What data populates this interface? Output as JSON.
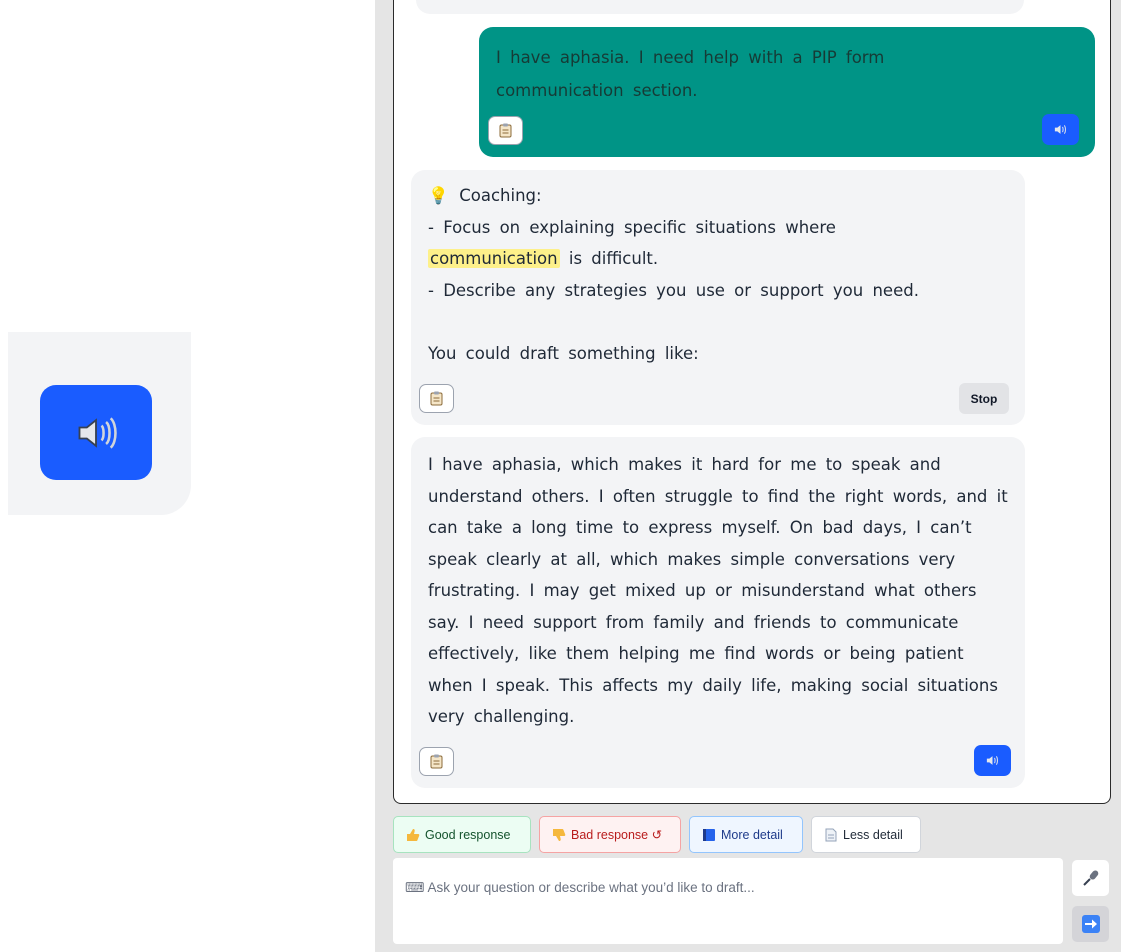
{
  "chat": {
    "user_message": "I have aphasia. I need help with a PIP form communication section.",
    "coaching": {
      "heading": "Coaching:",
      "line1_before": "- Focus on explaining specific situations where",
      "highlight": "communication",
      "line1_after": "is difficult.",
      "line2": "- Describe any strategies you use or support you need.",
      "line3": "You could draft something like:",
      "stop_label": "Stop"
    },
    "draft": "I have aphasia, which makes it hard for me to speak and understand others. I often struggle to find the right words, and it can take a long time to express myself. On bad days, I can’t speak clearly at all, which makes simple conversations very frustrating. I may get mixed up or misunderstand what others say. I need support from family and friends to communicate effectively, like them helping me find words or being patient when I speak. This affects my daily life, making social situations very challenging."
  },
  "feedback": {
    "good": "Good response",
    "bad": "Bad response ↺",
    "more": "More detail",
    "less": "Less detail"
  },
  "input": {
    "placeholder": "⌨ Ask your question or describe what you’d like to draft..."
  },
  "colors": {
    "accent_blue": "#1a5cff",
    "user_bubble": "#009486",
    "highlight": "#fdf08a"
  },
  "icons": [
    "speaker-icon",
    "clipboard-icon",
    "lightbulb-icon",
    "thumbs-up-icon",
    "thumbs-down-icon",
    "book-icon",
    "page-icon",
    "microphone-icon",
    "arrow-right-icon"
  ]
}
